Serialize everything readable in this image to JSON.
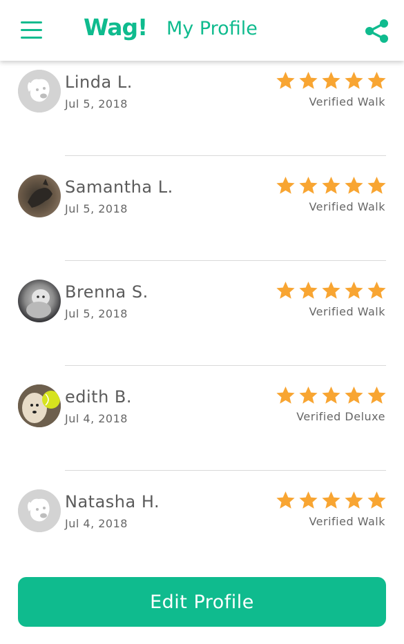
{
  "header": {
    "logo": "Wag!",
    "title": "My Profile"
  },
  "colors": {
    "brand": "#0fbb8e",
    "star": "#f8a532",
    "text": "#5b5b5b"
  },
  "reviews": [
    {
      "name": "Linda L.",
      "date": "Jul 5, 2018",
      "rating": 5,
      "walk_type": "Verified Walk",
      "avatar": "default-dog-icon"
    },
    {
      "name": "Samantha L.",
      "date": "Jul 5, 2018",
      "rating": 5,
      "walk_type": "Verified Walk",
      "avatar": "dog-photo"
    },
    {
      "name": "Brenna S.",
      "date": "Jul 5, 2018",
      "rating": 5,
      "walk_type": "Verified Walk",
      "avatar": "dog-photo"
    },
    {
      "name": "edith B.",
      "date": "Jul 4, 2018",
      "rating": 5,
      "walk_type": "Verified Deluxe",
      "avatar": "dog-photo"
    },
    {
      "name": "Natasha H.",
      "date": "Jul 4, 2018",
      "rating": 5,
      "walk_type": "Verified Walk",
      "avatar": "default-dog-icon"
    }
  ],
  "footer": {
    "edit_label": "Edit Profile"
  }
}
